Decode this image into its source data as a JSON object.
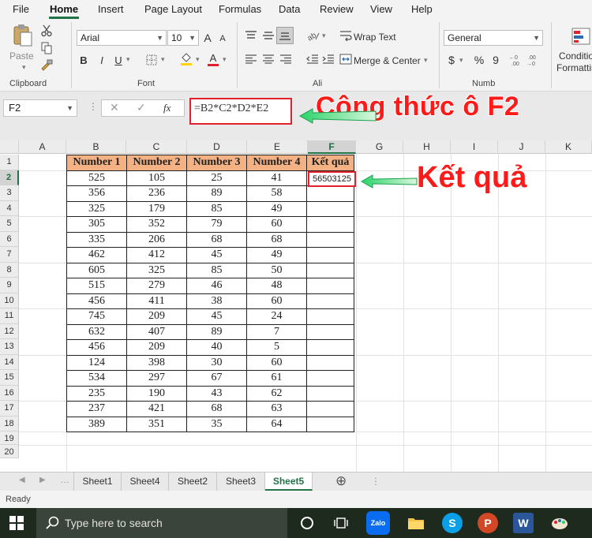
{
  "menu": {
    "items": [
      "File",
      "Home",
      "Insert",
      "Page Layout",
      "Formulas",
      "Data",
      "Review",
      "View",
      "Help"
    ],
    "active": "Home"
  },
  "ribbon": {
    "clipboard": {
      "paste_label": "Paste",
      "group_label": "Clipboard"
    },
    "font": {
      "font_name": "Arial",
      "font_size": "10",
      "group_label": "Font",
      "bold": "B",
      "italic": "I",
      "underline": "U",
      "grow": "A",
      "shrink": "A"
    },
    "alignment": {
      "wrap_text": "Wrap Text",
      "merge_center": "Merge & Center",
      "group_label": "Ali"
    },
    "number": {
      "format": "General",
      "currency": "$",
      "percent": "%",
      "comma": "9",
      "group_label": "Numb"
    },
    "styles": {
      "conditional_line1": "Conditio",
      "conditional_line2": "Formattin"
    }
  },
  "formula_bar": {
    "name_box": "F2",
    "cancel_icon": "✕",
    "enter_icon": "✓",
    "fx_label": "fx",
    "formula": "=B2*C2*D2*E2"
  },
  "annotations": {
    "formula_callout": "Công thức ô F2",
    "result_callout": "Kết quả",
    "accent_color": "#ff1a1a"
  },
  "grid": {
    "columns": [
      "A",
      "B",
      "C",
      "D",
      "E",
      "F",
      "G",
      "H",
      "I",
      "J",
      "K"
    ],
    "selected_column": "F",
    "rows": [
      "1",
      "2",
      "3",
      "4",
      "5",
      "6",
      "7",
      "8",
      "9",
      "10",
      "11",
      "12",
      "13",
      "14",
      "15",
      "16",
      "17",
      "18",
      "19",
      "20"
    ],
    "selected_row": "2",
    "header_fill": "#f4b183"
  },
  "table": {
    "headers": [
      "Number 1",
      "Number 2",
      "Number 3",
      "Number 4",
      "Kết quả"
    ],
    "rows": [
      [
        "525",
        "105",
        "25",
        "41",
        ""
      ],
      [
        "356",
        "236",
        "89",
        "58",
        ""
      ],
      [
        "325",
        "179",
        "85",
        "49",
        ""
      ],
      [
        "305",
        "352",
        "79",
        "60",
        ""
      ],
      [
        "335",
        "206",
        "68",
        "68",
        ""
      ],
      [
        "462",
        "412",
        "45",
        "49",
        ""
      ],
      [
        "605",
        "325",
        "85",
        "50",
        ""
      ],
      [
        "515",
        "279",
        "46",
        "48",
        ""
      ],
      [
        "456",
        "411",
        "38",
        "60",
        ""
      ],
      [
        "745",
        "209",
        "45",
        "24",
        ""
      ],
      [
        "632",
        "407",
        "89",
        "7",
        ""
      ],
      [
        "456",
        "209",
        "40",
        "5",
        ""
      ],
      [
        "124",
        "398",
        "30",
        "60",
        ""
      ],
      [
        "534",
        "297",
        "67",
        "61",
        ""
      ],
      [
        "235",
        "190",
        "43",
        "62",
        ""
      ],
      [
        "237",
        "421",
        "68",
        "63",
        ""
      ],
      [
        "389",
        "351",
        "35",
        "64",
        ""
      ]
    ],
    "f2_value": "56503125"
  },
  "sheets": {
    "tabs": [
      "Sheet1",
      "Sheet4",
      "Sheet2",
      "Sheet3",
      "Sheet5"
    ],
    "active": "Sheet5",
    "add_icon": "⊕"
  },
  "status": {
    "text": "Ready"
  },
  "taskbar": {
    "search_placeholder": "Type here to search",
    "zalo_label": "Zalo",
    "apps": [
      "cortana-icon",
      "task-view-icon",
      "zalo-icon",
      "file-explorer-icon",
      "skype-icon",
      "powerpoint-icon",
      "word-icon",
      "paint-icon"
    ]
  }
}
